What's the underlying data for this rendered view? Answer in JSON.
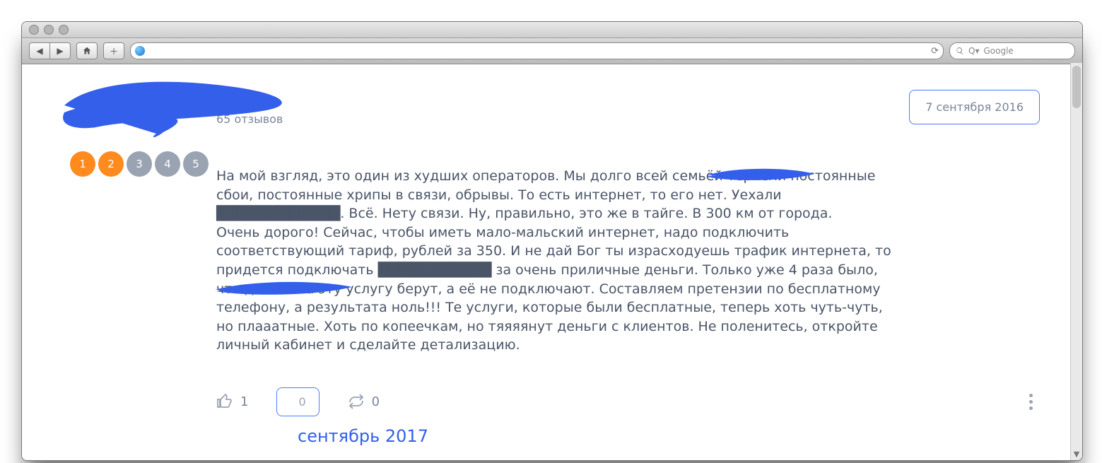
{
  "browser": {
    "search_placeholder": "Google"
  },
  "review": {
    "meta_reviews": "65 отзывов",
    "date": "7 сентября 2016",
    "rating_value": 2,
    "rating_labels": [
      "1",
      "2",
      "3",
      "4",
      "5"
    ],
    "para1": "На мой взгляд, это один из худших операторов. Мы долго всей семьёй терпели постоянные сбои, постоянные хрипы в связи, обрывы. То есть интернет, то его нет. Уехали ████████████. Всё. Нету связи. Ну, правильно, это же в тайге. В 300 км от города.",
    "para2": "Очень дорого! Сейчас, чтобы иметь мало-мальский интернет, надо подключить соответствующий тариф, рублей за 350. И не дай Бог ты израсходуешь трафик интернета, то придется подключать ███████████ за очень приличные деньги. Только уже 4 раза было, что деньги за эту услугу берут, а её не подключают. Составляем претензии по бесплатному телефону, а результата ноль!!! Те услуги, которые были бесплатные, теперь хоть чуть-чуть, но плааатные. Хоть по копеечкам, но тяяяянут деньги с клиентов. Не поленитесь, откройте личный кабинет и сделайте детализацию.",
    "likes": "1",
    "comments": "0",
    "shares": "0",
    "month_label": "сентябрь 2017"
  }
}
